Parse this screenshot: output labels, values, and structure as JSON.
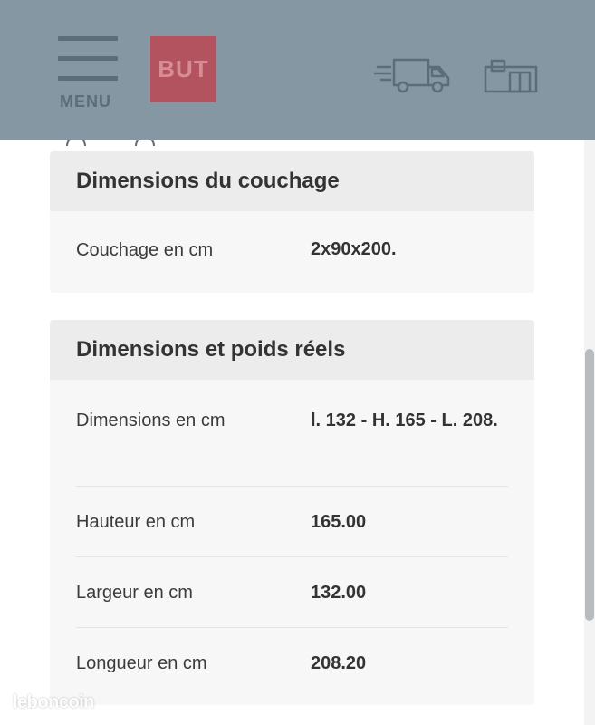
{
  "header": {
    "menu_label": "MENU",
    "logo_text": "BUT",
    "icons": [
      "menu-icon",
      "delivery-truck-icon",
      "store-icon"
    ],
    "colors": {
      "background": "#8597a3",
      "icon": "#5b6d79",
      "logo_bg": "#b2535f"
    }
  },
  "sections": [
    {
      "title": "Dimensions du couchage",
      "rows": [
        {
          "label": "Couchage en cm",
          "value": "2x90x200."
        }
      ]
    },
    {
      "title": "Dimensions et poids réels",
      "rows": [
        {
          "label": "Dimensions en cm",
          "value": "l. 132 - H. 165 - L. 208."
        },
        {
          "label": "Hauteur en cm",
          "value": "165.00"
        },
        {
          "label": "Largeur en cm",
          "value": "132.00"
        },
        {
          "label": "Longueur en cm",
          "value": "208.20"
        }
      ]
    }
  ],
  "watermark": "leboncoin"
}
